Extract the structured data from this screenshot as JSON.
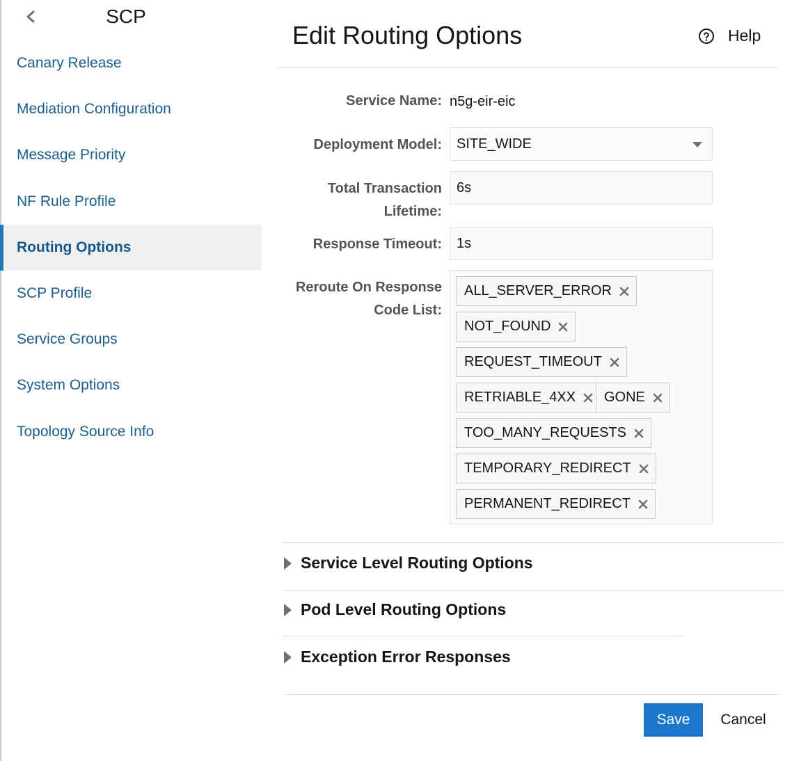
{
  "sidebar": {
    "title": "SCP",
    "items": [
      {
        "label": "Canary Release"
      },
      {
        "label": "Mediation Configuration"
      },
      {
        "label": "Message Priority"
      },
      {
        "label": "NF Rule Profile"
      },
      {
        "label": "Routing Options",
        "active": true
      },
      {
        "label": "SCP Profile"
      },
      {
        "label": "Service Groups"
      },
      {
        "label": "System Options"
      },
      {
        "label": "Topology Source Info"
      }
    ]
  },
  "header": {
    "title": "Edit Routing Options",
    "help_label": "Help"
  },
  "form": {
    "service_name": {
      "label": "Service Name:",
      "value": "n5g-eir-eic"
    },
    "deployment_model": {
      "label": "Deployment Model:",
      "value": "SITE_WIDE"
    },
    "total_transaction_lifetime": {
      "label_line1": "Total Transaction",
      "label_line2": "Lifetime:",
      "value": "6s"
    },
    "response_timeout": {
      "label": "Response Timeout:",
      "value": "1s"
    },
    "reroute_codes": {
      "label_line1": "Reroute On Response",
      "label_line2": "Code List:",
      "chips": [
        "ALL_SERVER_ERROR",
        "NOT_FOUND",
        "REQUEST_TIMEOUT",
        "RETRIABLE_4XX",
        "GONE",
        "TOO_MANY_REQUESTS",
        "TEMPORARY_REDIRECT",
        "PERMANENT_REDIRECT"
      ]
    }
  },
  "sections": [
    {
      "label": "Service Level Routing Options"
    },
    {
      "label": "Pod Level Routing Options"
    },
    {
      "label": "Exception Error Responses"
    }
  ],
  "actions": {
    "save_label": "Save",
    "cancel_label": "Cancel"
  },
  "colors": {
    "accent": "#1b77c9",
    "nav_link": "#1b5e8c",
    "active_bar": "#227ab3"
  },
  "icons": {
    "back": "chevron-left-icon",
    "help": "question-circle-icon",
    "dropdown": "caret-down-icon",
    "chip_remove": "close-icon",
    "section_toggle": "triangle-right-icon"
  }
}
